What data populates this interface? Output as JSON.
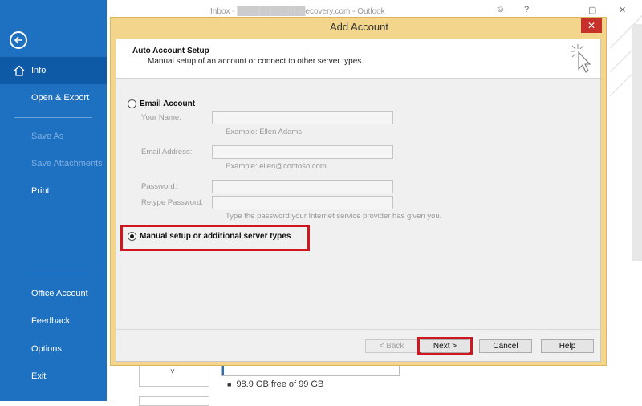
{
  "background_window": {
    "title_prefix": "Inbox - ",
    "title_suffix": "ecovery.com  -  Outlook",
    "help_glyph": "?",
    "storage": {
      "free_text": "98.9 GB free of 99 GB",
      "used_fraction": 0.01
    },
    "mailbox_chevron": "˅"
  },
  "sidebar": {
    "items": [
      {
        "label": "Info",
        "active": true,
        "disabled": false
      },
      {
        "label": "Open & Export",
        "active": false,
        "disabled": false
      },
      {
        "label": "Save As",
        "active": false,
        "disabled": true
      },
      {
        "label": "Save Attachments",
        "active": false,
        "disabled": true
      },
      {
        "label": "Print",
        "active": false,
        "disabled": false
      },
      {
        "label": "Office Account",
        "active": false,
        "disabled": false
      },
      {
        "label": "Feedback",
        "active": false,
        "disabled": false
      },
      {
        "label": "Options",
        "active": false,
        "disabled": false
      },
      {
        "label": "Exit",
        "active": false,
        "disabled": false
      }
    ]
  },
  "dialog": {
    "title": "Add Account",
    "close_glyph": "✕",
    "header": {
      "title": "Auto Account Setup",
      "subtitle": "Manual setup of an account or connect to other server types."
    },
    "email_account": {
      "label": "Email Account",
      "selected": false,
      "fields": {
        "name_label": "Your Name:",
        "name_hint": "Example: Ellen Adams",
        "email_label": "Email Address:",
        "email_hint": "Example: ellen@contoso.com",
        "password_label": "Password:",
        "retype_label": "Retype Password:",
        "password_hint": "Type the password your Internet service provider has given you."
      }
    },
    "manual_setup": {
      "label": "Manual setup or additional server types",
      "selected": true
    },
    "buttons": {
      "back": "< Back",
      "next": "Next >",
      "cancel": "Cancel",
      "help": "Help"
    }
  },
  "colors": {
    "sidebar": "#1e70c0",
    "sidebar_active": "#0f5aa6",
    "dialog_frame": "#f3d68b",
    "close": "#c7312b",
    "highlight": "#d01720"
  }
}
